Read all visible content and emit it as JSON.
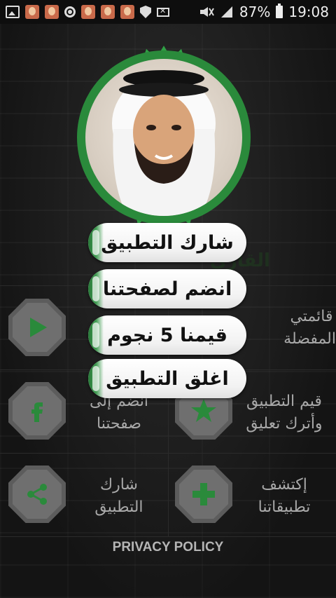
{
  "status_bar": {
    "left_icons": [
      "gallery-icon",
      "contact-photo-icon",
      "contact-photo-icon",
      "ring-icon",
      "contact-photo-icon",
      "contact-photo-icon",
      "contact-photo-icon",
      "shield-icon",
      "mail-icon"
    ],
    "signal_icons": [
      "mute-icon",
      "signal-icon"
    ],
    "battery": "87%",
    "time": "19:08"
  },
  "header": {
    "faded_title": "القارئ"
  },
  "popup_menu": {
    "items": [
      {
        "label": "شارك التطبيق"
      },
      {
        "label": "انضم لصفحتنا"
      },
      {
        "label": "قيمنا 5 نجوم"
      },
      {
        "label": "اغلق التطبيق"
      }
    ]
  },
  "grid": {
    "cells": [
      {
        "label_line1": "قائمتي",
        "label_line2": "المفضلة",
        "icon": "play-icon"
      },
      {
        "label_line1": "انضم إلى",
        "label_line2": "صفحتنا",
        "icon": "facebook-icon"
      },
      {
        "label_line1": "قيم التطبيق",
        "label_line2": "وأترك تعليق",
        "icon": "star-icon"
      },
      {
        "label_line1": "شارك",
        "label_line2": "التطبيق",
        "icon": "share-icon"
      },
      {
        "label_line1": "إكتشف",
        "label_line2": "تطبيقاتنا",
        "icon": "plus-icon"
      }
    ]
  },
  "footer": {
    "privacy_label": "PRIVACY POLICY"
  },
  "colors": {
    "accent_green": "#2f8a3f",
    "hex_gray": "#6f6f6f",
    "background": "#1a1a1a"
  }
}
